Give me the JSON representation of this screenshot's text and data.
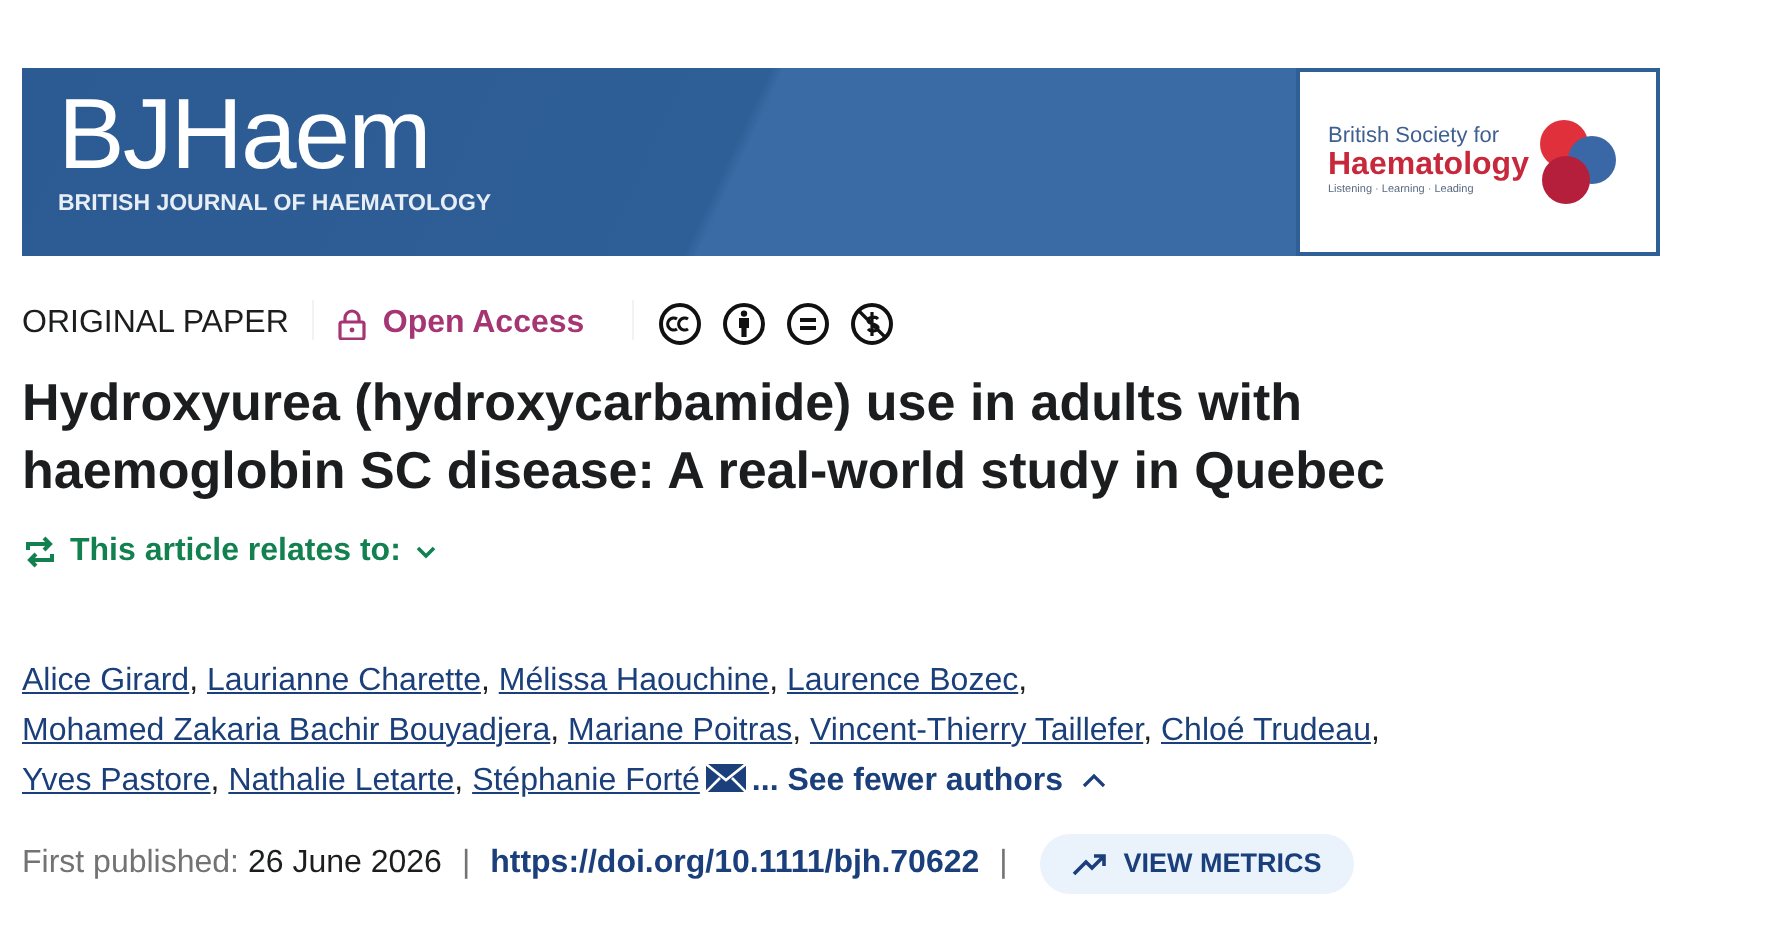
{
  "banner": {
    "journal_logo": "BJHaem",
    "journal_subtitle": "BRITISH JOURNAL OF HAEMATOLOGY",
    "society_line1": "British Society for",
    "society_line2": "Haematology",
    "society_tagline": "Listening · Learning · Leading"
  },
  "meta": {
    "article_type": "ORIGINAL PAPER",
    "access": "Open Access"
  },
  "title": "Hydroxyurea (hydroxycarbamide) use in adults with haemoglobin SC disease: A real-world study in Quebec",
  "relates": {
    "label": "This article relates to:",
    "expanded": false
  },
  "author_lines": [
    [
      {
        "name": "Alice Girard",
        "separator": ","
      },
      {
        "name": "Laurianne Charette",
        "separator": ","
      },
      {
        "name": "Mélissa Haouchine",
        "separator": ","
      },
      {
        "name": "Laurence Bozec",
        "separator": ","
      }
    ],
    [
      {
        "name": "Mohamed Zakaria Bachir Bouyadjera",
        "separator": ","
      },
      {
        "name": "Mariane Poitras",
        "separator": ","
      },
      {
        "name": "Vincent-Thierry Taillefer",
        "separator": ","
      },
      {
        "name": "Chloé Trudeau",
        "separator": ","
      }
    ],
    [
      {
        "name": "Yves Pastore",
        "separator": ","
      },
      {
        "name": "Nathalie Letarte",
        "separator": ","
      },
      {
        "name": "Stéphanie Forté",
        "corresponding": true
      }
    ]
  ],
  "authors_toggle": {
    "label": "... See fewer authors",
    "expanded": true
  },
  "published": {
    "label": "First published:",
    "date": "26 June 2026",
    "sep1": "|",
    "doi": "https://doi.org/10.1111/bjh.70622",
    "sep2": "|",
    "metrics": "VIEW METRICS"
  }
}
